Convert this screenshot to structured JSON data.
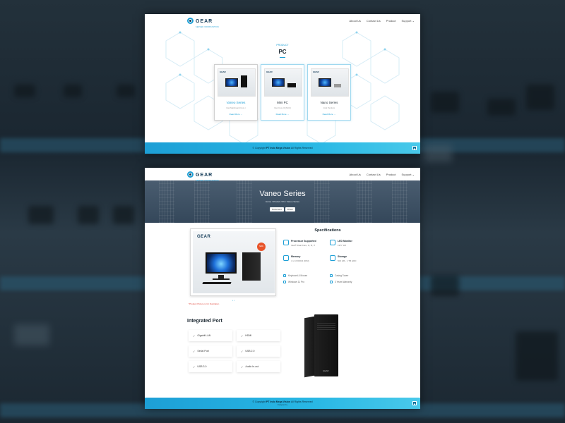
{
  "nav": {
    "brand": "GEAR",
    "brand_sub": "SERVER WORKSTATION",
    "page1_items": [
      "About Us",
      "Contact Us",
      "Product",
      "Support"
    ],
    "page2_items": [
      "About Us",
      "Contact Us",
      "Product",
      "Support"
    ]
  },
  "products_page": {
    "category": "PRODUCT",
    "title": "PC",
    "cards": [
      {
        "name": "Vaneo Series",
        "desc": "Intel Mainboard Core i",
        "link": "Read More →",
        "card_logo": "GEAR",
        "active": true
      },
      {
        "name": "Mini PC",
        "desc": "Intel Core i3 (NUC)",
        "link": "Read More →",
        "card_logo": "GEAR",
        "active": false
      },
      {
        "name": "Nano Series",
        "desc": "Intel Pentium",
        "link": "Read More →",
        "card_logo": "GEAR",
        "active": false
      }
    ]
  },
  "footer": {
    "copyright": "© Copyright",
    "company": "PT Indo Mega Vision",
    "rights": "All Rights Reserved",
    "sub": "Designed by"
  },
  "detail_page": {
    "title": "Vaneo Series",
    "breadcrumb": "Home  /  Product  /  PC  /  Vaneo Series",
    "buttons": [
      "Document",
      "Driver"
    ],
    "gallery": {
      "logo": "GEAR",
      "badge": "NEW",
      "indicator": "• •",
      "note": "*Product Picture is for illustration"
    },
    "specs_title": "Specifications",
    "specs": [
      {
        "label": "Processor Supported",
        "value": "Intel® Dual Core, i3, i5, i7"
      },
      {
        "label": "LED Monitor",
        "value": "19.5\" LM"
      },
      {
        "label": "Memory",
        "value": "4 x 16 DDR4 (DIM)"
      },
      {
        "label": "Storage",
        "value": "500 GB - 1 TB HDD"
      }
    ],
    "features": [
      "Keyboard & Mouse",
      "Casing Tower",
      "Windows 11 Pro",
      "3 Years Warranty"
    ],
    "ports_title": "Integrated Port",
    "ports": [
      "Gigabit LAN",
      "HDMI",
      "Serial Port",
      "USB 2.0",
      "USB 3.0",
      "Audio In-out"
    ],
    "tower_label": "GEAR"
  }
}
